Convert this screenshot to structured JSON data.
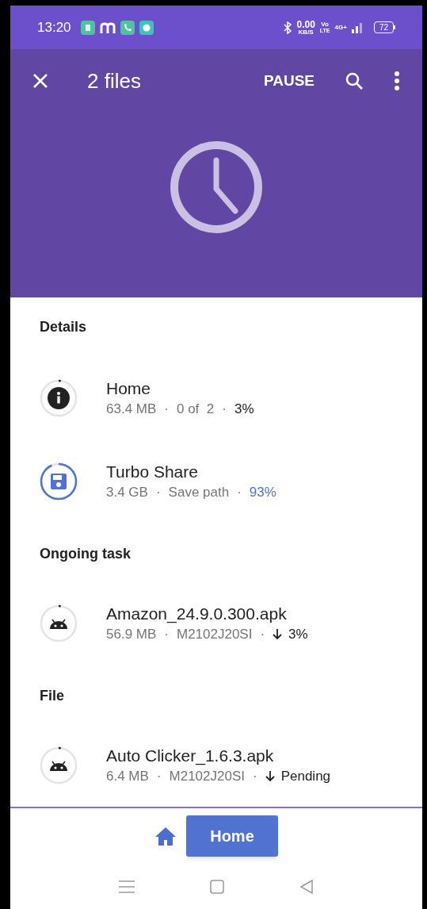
{
  "status_bar": {
    "time": "13:20",
    "speed": "0.00",
    "speed_unit": "KB/S",
    "volte_top": "Vo",
    "volte_bottom": "LTE",
    "network": "4G+",
    "battery": "72"
  },
  "app_bar": {
    "title": "2 files",
    "action": "PAUSE"
  },
  "sections": [
    {
      "title": "Details",
      "items": [
        {
          "kind": "info",
          "name": "Home",
          "meta": [
            "63.4 MB",
            "·",
            "0 of  2",
            "·"
          ],
          "status": "3%",
          "accent": false,
          "arrow": false
        },
        {
          "kind": "save",
          "name": "Turbo Share",
          "meta": [
            "3.4 GB",
            "·",
            "Save path",
            "·"
          ],
          "status": "93%",
          "accent": true,
          "arrow": false
        }
      ]
    },
    {
      "title": "Ongoing task",
      "items": [
        {
          "kind": "android",
          "name": "Amazon_24.9.0.300.apk",
          "meta": [
            "56.9 MB",
            "·",
            "M2102J20SI",
            "·"
          ],
          "status": "3%",
          "accent": false,
          "arrow": true
        }
      ]
    },
    {
      "title": "File",
      "items": [
        {
          "kind": "android",
          "name": "Auto Clicker_1.6.3.apk",
          "meta": [
            "6.4 MB",
            "·",
            "M2102J20SI",
            "·"
          ],
          "status": "Pending",
          "accent": false,
          "arrow": true
        }
      ]
    }
  ],
  "bottom_button": {
    "label": "Home"
  }
}
